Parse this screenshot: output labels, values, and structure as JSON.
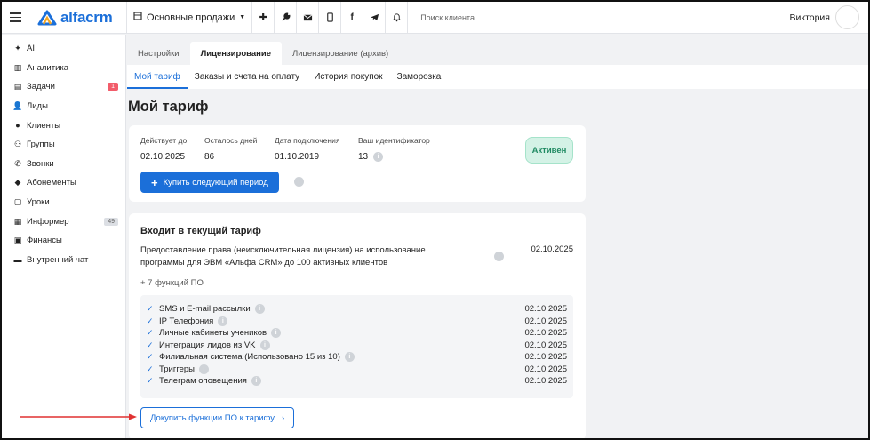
{
  "app": {
    "logo_text": "alfacrm",
    "brand_color": "#1b6fd9"
  },
  "topbar": {
    "branch_label": "Основные продажи",
    "icons": [
      "plus-icon",
      "wrench-icon",
      "mail-icon",
      "phone-icon",
      "facebook-icon",
      "telegram-icon",
      "bell-icon"
    ],
    "search_placeholder": "Поиск клиента",
    "user_name": "Виктория"
  },
  "sidebar": {
    "items": [
      {
        "label": "AI",
        "icon": "sparkle-icon"
      },
      {
        "label": "Аналитика",
        "icon": "analytics-icon"
      },
      {
        "label": "Задачи",
        "icon": "tasks-icon",
        "badge": "1"
      },
      {
        "label": "Лиды",
        "icon": "leads-icon"
      },
      {
        "label": "Клиенты",
        "icon": "client-icon"
      },
      {
        "label": "Группы",
        "icon": "groups-icon"
      },
      {
        "label": "Звонки",
        "icon": "phone-icon"
      },
      {
        "label": "Абонементы",
        "icon": "tag-icon"
      },
      {
        "label": "Уроки",
        "icon": "calendar-icon"
      },
      {
        "label": "Информер",
        "icon": "informer-icon",
        "badge": "49"
      },
      {
        "label": "Финансы",
        "icon": "finance-icon"
      },
      {
        "label": "Внутренний чат",
        "icon": "chat-icon"
      }
    ]
  },
  "tabs_top": [
    "Настройки",
    "Лицензирование",
    "Лицензирование (архив)"
  ],
  "tabs_sub": [
    "Мой тариф",
    "Заказы и счета на оплату",
    "История покупок",
    "Заморозка"
  ],
  "page_title": "Мой тариф",
  "tariff": {
    "cols": [
      {
        "label": "Действует до",
        "value": "02.10.2025"
      },
      {
        "label": "Осталось дней",
        "value": "86"
      },
      {
        "label": "Дата подключения",
        "value": "01.10.2019"
      },
      {
        "label": "Ваш идентификатор",
        "value": "13"
      }
    ],
    "status": "Активен",
    "buy_button": "Купить следующий период"
  },
  "included": {
    "title": "Входит в текущий тариф",
    "license_line1": "Предоставление права (неисключительная лицензия) на использование",
    "license_line2": "программы для ЭВМ «Альфа CRM» до 100 активных клиентов",
    "license_date": "02.10.2025",
    "functions_link": "+ 7 функций ПО",
    "functions": [
      {
        "name": "SMS и E-mail рассылки",
        "date": "02.10.2025"
      },
      {
        "name": "IP Телефония",
        "date": "02.10.2025"
      },
      {
        "name": "Личные кабинеты учеников",
        "date": "02.10.2025"
      },
      {
        "name": "Интеграция лидов из VK",
        "date": "02.10.2025"
      },
      {
        "name": "Филиальная система (Использовано 15 из 10)",
        "date": "02.10.2025"
      },
      {
        "name": "Триггеры",
        "date": "02.10.2025"
      },
      {
        "name": "Телеграм оповещения",
        "date": "02.10.2025"
      }
    ],
    "addon_button": "Докупить функции ПО к тарифу"
  }
}
